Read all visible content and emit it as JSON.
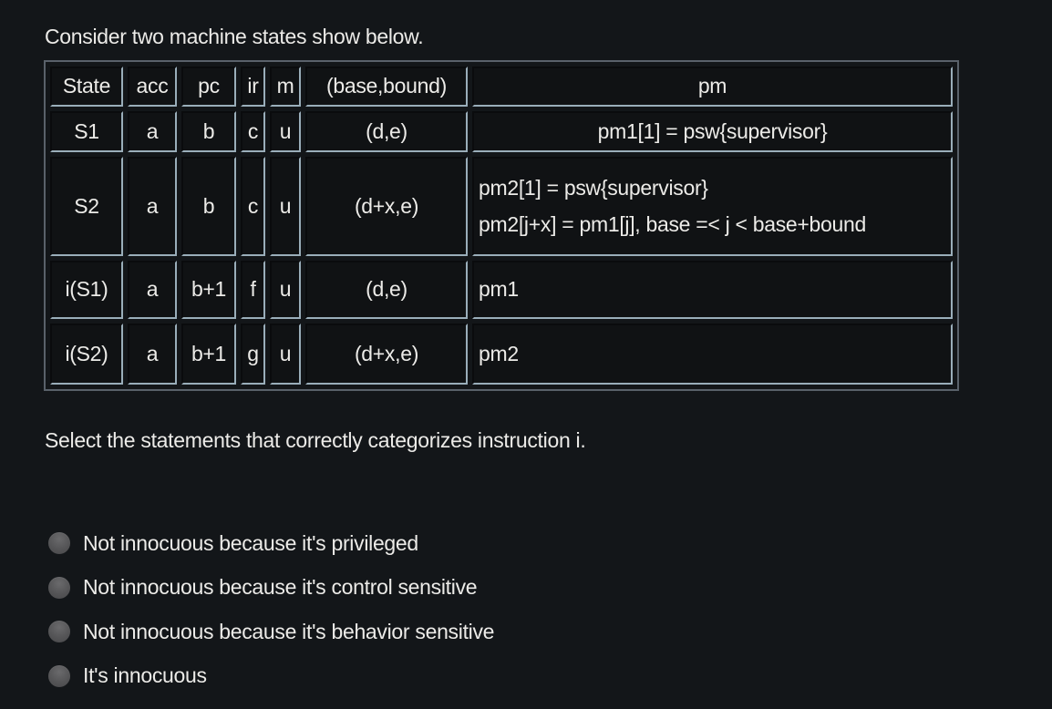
{
  "intro_text": "Consider two machine states show below.",
  "table": {
    "headers": [
      "State",
      "acc",
      "pc",
      "ir",
      "m",
      "(base,bound)",
      "pm"
    ],
    "rows": [
      {
        "state": "S1",
        "acc": "a",
        "pc": "b",
        "ir": "c",
        "m": "u",
        "base_bound": "(d,e)",
        "pm": [
          "pm1[1] = psw{supervisor}"
        ]
      },
      {
        "state": "S2",
        "acc": "a",
        "pc": "b",
        "ir": "c",
        "m": "u",
        "base_bound": "(d+x,e)",
        "pm": [
          "pm2[1] = psw{supervisor}",
          "pm2[j+x] = pm1[j], base =< j < base+bound"
        ]
      },
      {
        "state": "i(S1)",
        "acc": "a",
        "pc": "b+1",
        "ir": "f",
        "m": "u",
        "base_bound": "(d,e)",
        "pm": [
          "pm1"
        ]
      },
      {
        "state": "i(S2)",
        "acc": "a",
        "pc": "b+1",
        "ir": "g",
        "m": "u",
        "base_bound": "(d+x,e)",
        "pm": [
          "pm2"
        ]
      }
    ]
  },
  "question_text": "Select the statements that correctly categorizes instruction i.",
  "options": [
    {
      "label": "Not innocuous because it's privileged",
      "selected": false
    },
    {
      "label": "Not innocuous because it's control sensitive",
      "selected": false
    },
    {
      "label": "Not innocuous because it's behavior sensitive",
      "selected": false
    },
    {
      "label": "It's innocuous",
      "selected": false
    }
  ]
}
